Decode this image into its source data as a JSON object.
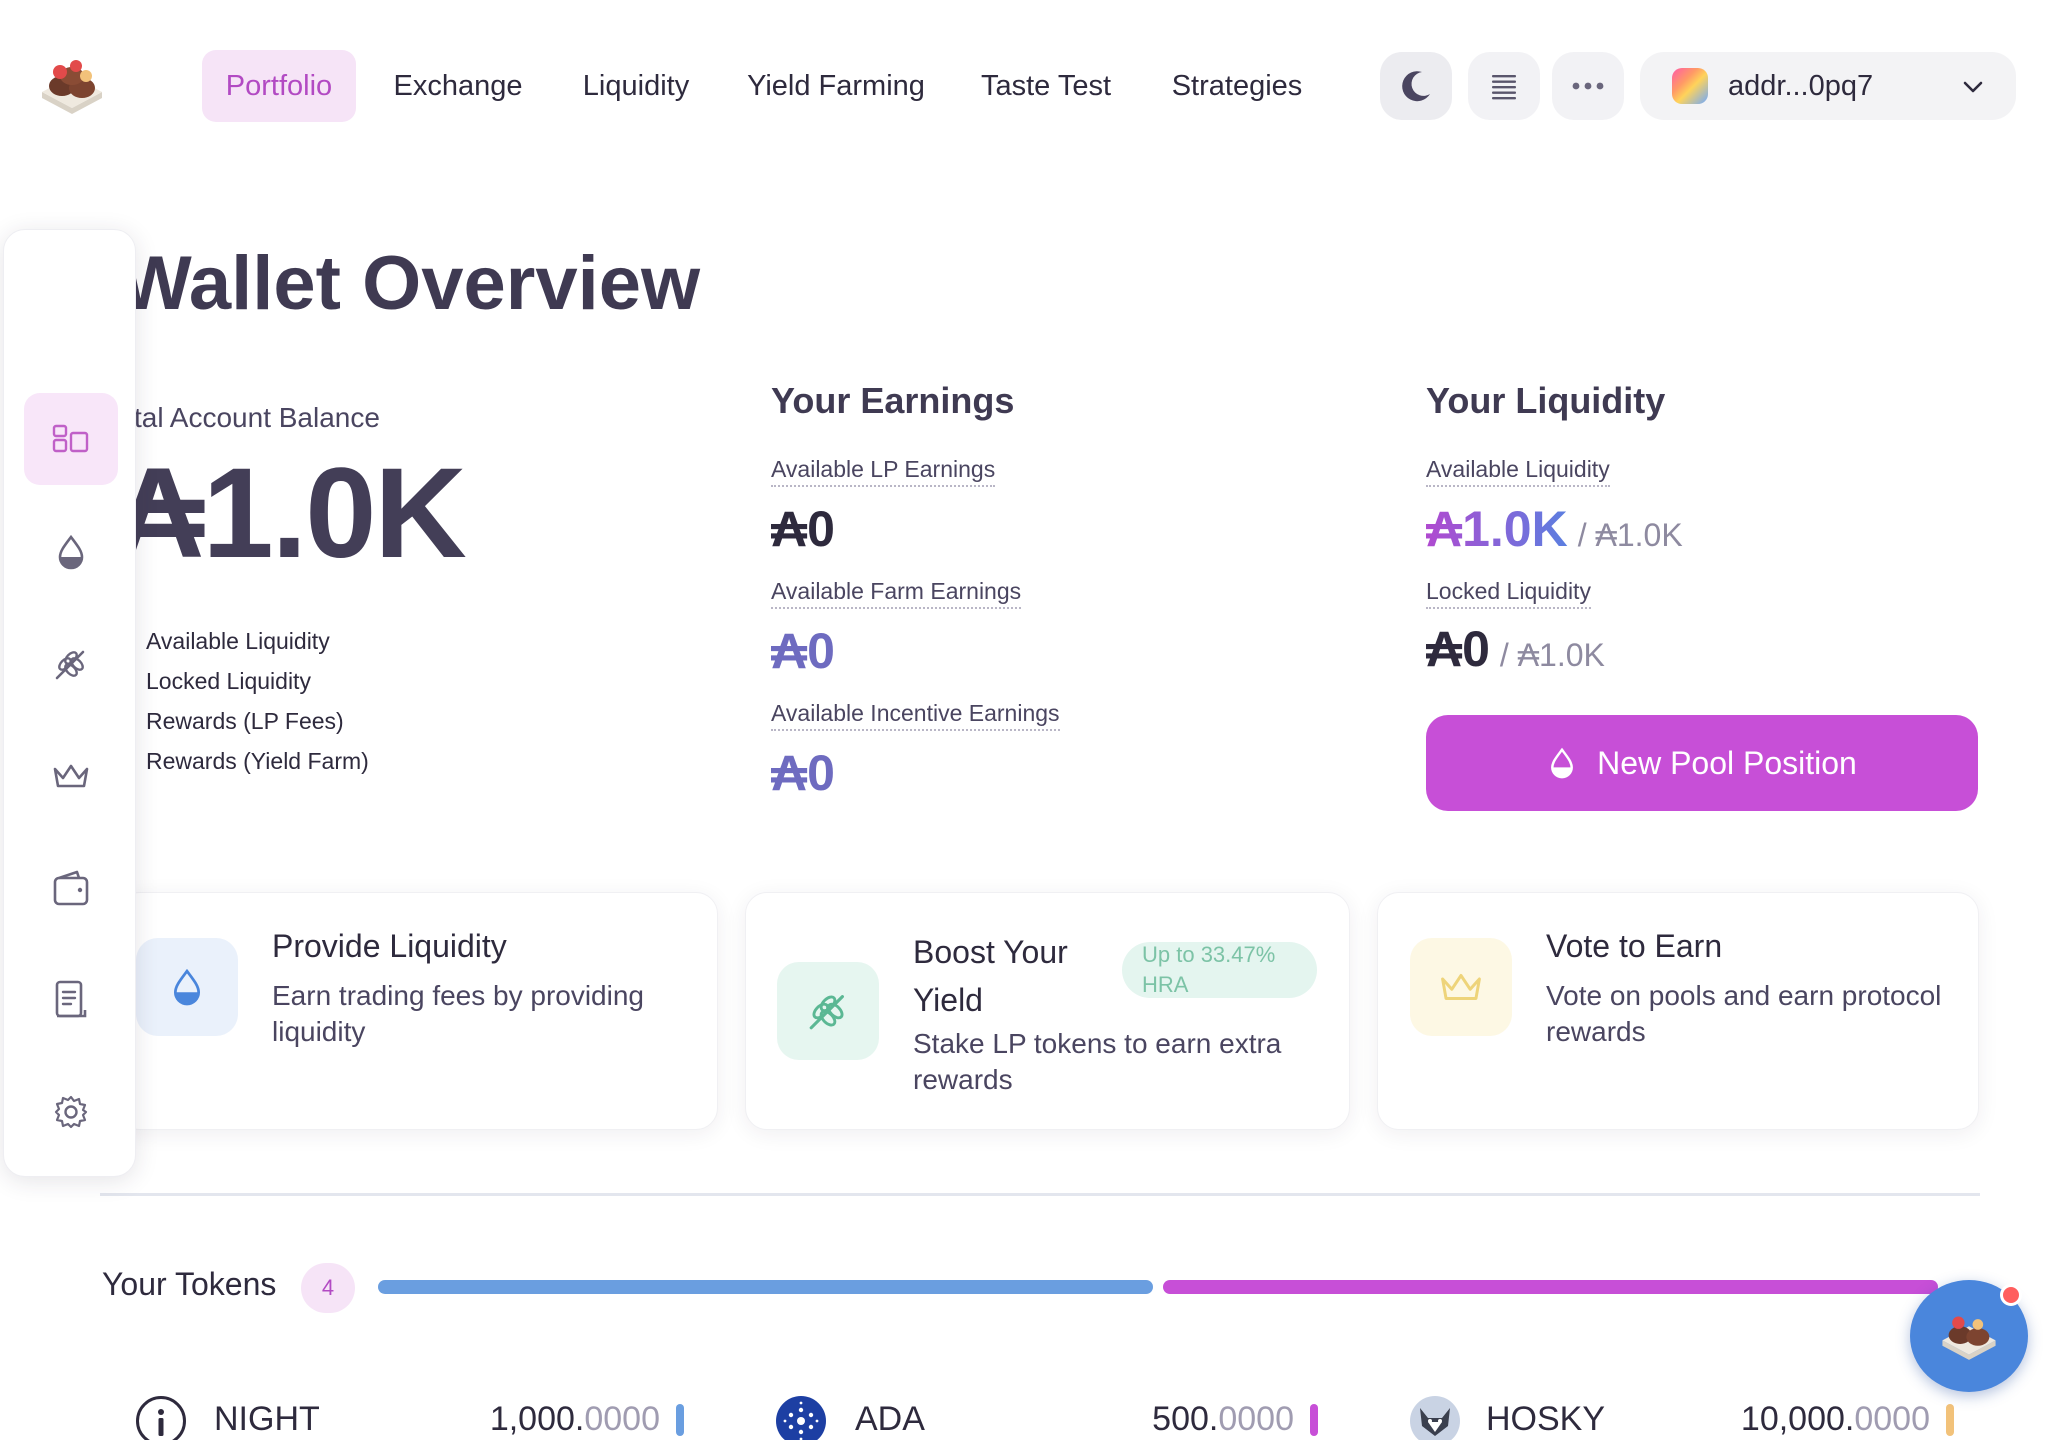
{
  "nav": {
    "items": [
      {
        "label": "Portfolio",
        "active": true
      },
      {
        "label": "Exchange",
        "active": false
      },
      {
        "label": "Liquidity",
        "active": false
      },
      {
        "label": "Yield Farming",
        "active": false
      },
      {
        "label": "Taste Test",
        "active": false
      },
      {
        "label": "Strategies",
        "active": false
      }
    ],
    "theme_icon": "moon-icon",
    "list_icon": "list-icon",
    "more_icon": "more-dots-icon",
    "wallet_address": "addr...0pq7"
  },
  "sidebar": {
    "items": [
      {
        "icon": "dashboard-icon",
        "active": true
      },
      {
        "icon": "drop-icon",
        "active": false
      },
      {
        "icon": "wheat-icon",
        "active": false
      },
      {
        "icon": "crown-icon",
        "active": false
      },
      {
        "icon": "wallet-icon",
        "active": false
      },
      {
        "icon": "ledger-icon",
        "active": false
      },
      {
        "icon": "gear-icon",
        "active": false
      }
    ]
  },
  "overview": {
    "title": "Wallet Overview",
    "balance_label": "tal Account Balance",
    "balance_value": "₳1.0K",
    "legend": [
      "Available Liquidity",
      "Locked Liquidity",
      "Rewards (LP Fees)",
      "Rewards (Yield Farm)"
    ]
  },
  "earnings": {
    "title": "Your Earnings",
    "lp_label": "Available LP Earnings",
    "lp_value": "₳0",
    "farm_label": "Available Farm Earnings",
    "farm_value": "₳0",
    "incentive_label": "Available Incentive Earnings",
    "incentive_value": "₳0"
  },
  "liquidity": {
    "title": "Your Liquidity",
    "available_label": "Available Liquidity",
    "available_value": "₳1.0K",
    "available_total": "/ ₳1.0K",
    "locked_label": "Locked Liquidity",
    "locked_value": "₳0",
    "locked_total": "/ ₳1.0K",
    "button_label": "New Pool Position"
  },
  "cards": [
    {
      "title": "Provide Liquidity",
      "desc": "Earn trading fees by providing liquidity",
      "icon": "drop-icon"
    },
    {
      "title": "Boost Your Yield",
      "desc": "Stake LP tokens to earn extra rewards",
      "badge": "Up to 33.47% HRA",
      "icon": "wheat-icon"
    },
    {
      "title": "Vote to Earn",
      "desc": "Vote on pools and earn protocol rewards",
      "icon": "crown-icon"
    }
  ],
  "tokens": {
    "title": "Your Tokens",
    "count": "4",
    "allocation": [
      {
        "color": "#6a9ee0",
        "fraction": 0.5
      },
      {
        "color": "#c74fd7",
        "fraction": 0.5
      }
    ],
    "list": [
      {
        "name": "NIGHT",
        "amount_int": "1,000.",
        "amount_dec": "0000",
        "color": "#6a9ee0",
        "icon": "night-token-icon"
      },
      {
        "name": "ADA",
        "amount_int": "500.",
        "amount_dec": "0000",
        "color": "#c74fd7",
        "icon": "ada-token-icon"
      },
      {
        "name": "HOSKY",
        "amount_int": "10,000.",
        "amount_dec": "0000",
        "color": "#f2c27a",
        "icon": "hosky-token-icon"
      }
    ]
  },
  "colors": {
    "accent": "#c74fd7",
    "accent_soft": "#f6e4f7",
    "blue": "#6a9ee0"
  }
}
